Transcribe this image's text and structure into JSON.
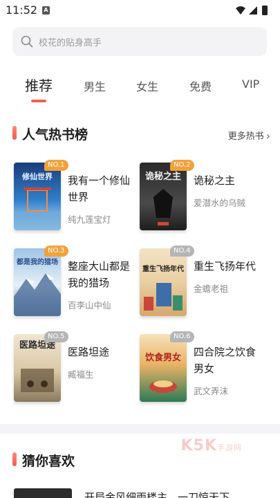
{
  "status_bar": {
    "time": "11:52",
    "app_badge": "A"
  },
  "search": {
    "placeholder": "校花的贴身高手"
  },
  "tabs": [
    {
      "label": "推荐",
      "active": true
    },
    {
      "label": "男生"
    },
    {
      "label": "女生"
    },
    {
      "label": "免费"
    },
    {
      "label": "VIP"
    }
  ],
  "hot_section": {
    "title": "人气热书榜",
    "more_label": "更多热书",
    "books": [
      {
        "rank": "NO.1",
        "title": "我有一个修仙世界",
        "author": "纯九莲宝灯",
        "cover_text": "修仙世界"
      },
      {
        "rank": "NO.2",
        "title": "诡秘之主",
        "author": "爱潜水的乌贼",
        "cover_text": "诡秘之主"
      },
      {
        "rank": "NO.3",
        "title": "整座大山都是我的猎场",
        "author": "百李山中仙",
        "cover_text": "都是我的猎场"
      },
      {
        "rank": "NO.4",
        "title": "重生飞扬年代",
        "author": "金蟾老祖",
        "cover_text": "重生飞扬年代"
      },
      {
        "rank": "NO.5",
        "title": "医路坦途",
        "author": "臧福生",
        "cover_text": "医路坦途"
      },
      {
        "rank": "NO.6",
        "title": "四合院之饮食男女",
        "author": "武文弄沫",
        "cover_text": "饮食男女"
      }
    ]
  },
  "guess_section": {
    "title": "猜你喜欢",
    "first_item_text": "开局金风细雨楼主，一刀惊天下"
  },
  "watermark": {
    "text": "K5K",
    "sub": "手游网"
  },
  "colors": {
    "accent": "#f0634f",
    "rank_gold": "#f2a13a",
    "rank_gray": "#b5b5b5"
  }
}
